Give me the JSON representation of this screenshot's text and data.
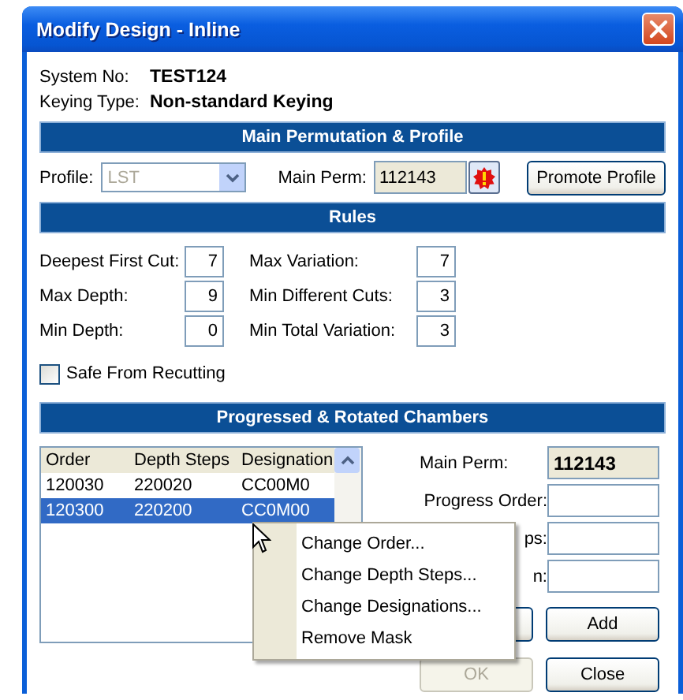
{
  "window": {
    "title": "Modify Design - Inline"
  },
  "info": [
    {
      "label": "System No:",
      "value": "TEST124"
    },
    {
      "label": "Keying Type:",
      "value": "Non-standard Keying"
    }
  ],
  "main_permutation": {
    "heading": "Main Permutation & Profile",
    "profile": {
      "label": "Profile:",
      "value": "LST",
      "disabled": true
    },
    "main_perm": {
      "label": "Main Perm:",
      "value": "112143"
    },
    "promote_button": "Promote Profile"
  },
  "rules": {
    "heading": "Rules",
    "fields": [
      {
        "label": "Deepest First Cut:",
        "value": "7"
      },
      {
        "label": "Max Variation:",
        "value": "7"
      },
      {
        "label": "Max Depth:",
        "value": "9"
      },
      {
        "label": "Min Different Cuts:",
        "value": "3"
      },
      {
        "label": "Min Depth:",
        "value": "0"
      },
      {
        "label": "Min Total Variation:",
        "value": "3"
      }
    ],
    "safe_from_recutting": {
      "label": "Safe From Recutting",
      "checked": false
    }
  },
  "chambers": {
    "heading": "Progressed & Rotated Chambers",
    "list": {
      "columns": [
        "Order",
        "Depth Steps",
        "Designation"
      ],
      "rows": [
        {
          "cells": [
            "120030",
            "220020",
            "CC00M0"
          ],
          "selected": false
        },
        {
          "cells": [
            "120300",
            "220200",
            "CC0M00"
          ],
          "selected": true
        }
      ]
    },
    "fields": [
      {
        "label": "Main Perm:",
        "value": "112143",
        "kind": "readonly"
      },
      {
        "label": "Progress Order:",
        "kind": "input"
      },
      {
        "label": "ps:",
        "kind": "input"
      },
      {
        "label": "n:",
        "kind": "input"
      }
    ],
    "buttons": [
      {
        "disabled": false
      },
      {
        "label": "Add",
        "disabled": false
      },
      {
        "label": "OK",
        "disabled": true
      },
      {
        "label": "Close",
        "disabled": false
      }
    ]
  },
  "context_menu": {
    "items": [
      "Change Order...",
      "Change Depth Steps...",
      "Change Designations...",
      "Remove Mask"
    ]
  }
}
